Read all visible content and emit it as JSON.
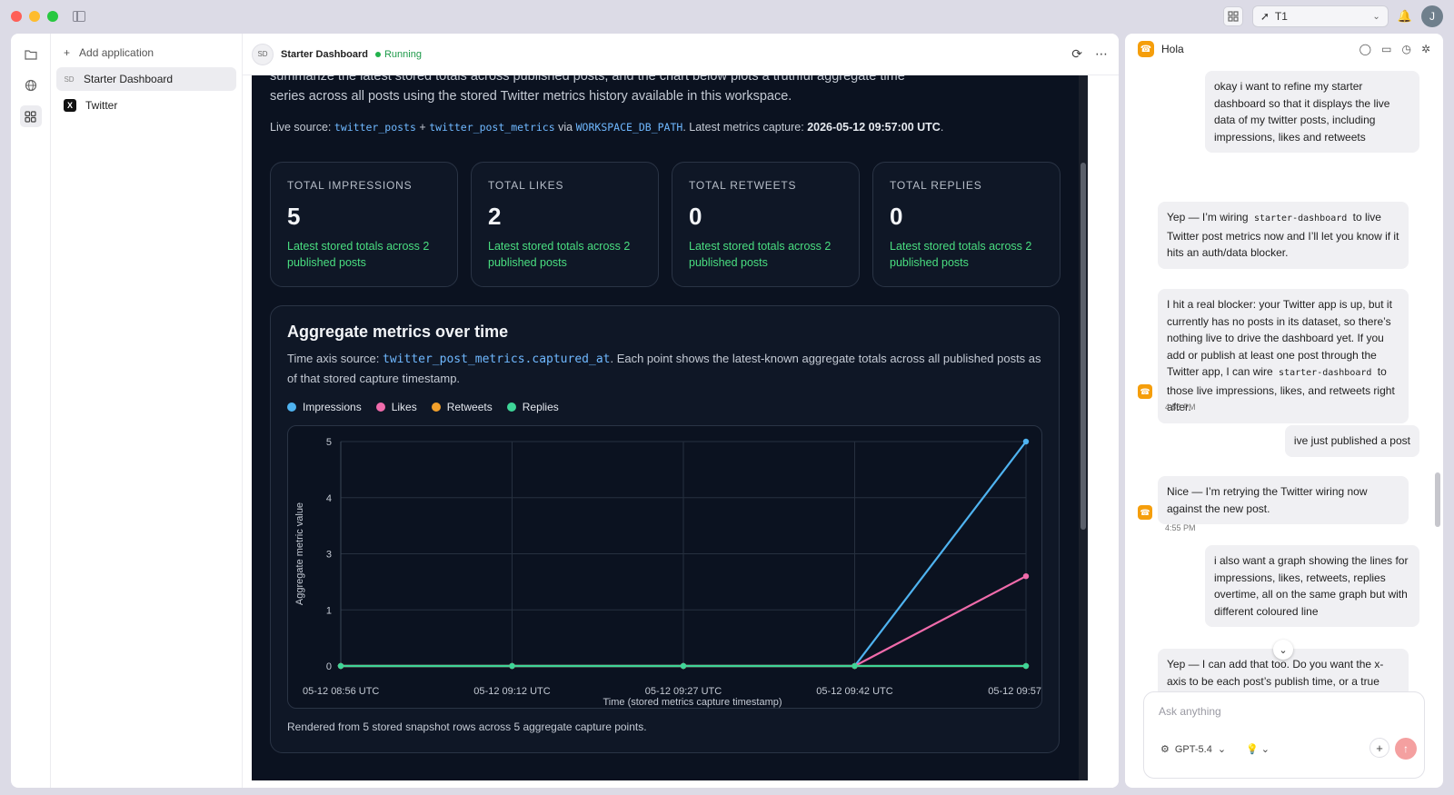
{
  "window": {
    "workspace": "T1",
    "avatar_initial": "J"
  },
  "nav": {
    "add_label": "Add application",
    "items": [
      {
        "badge": "SD",
        "label": "Starter Dashboard"
      },
      {
        "badge": "X",
        "label": "Twitter"
      }
    ]
  },
  "app_header": {
    "chip": "SD",
    "title": "Starter Dashboard",
    "status": "Running"
  },
  "dashboard": {
    "intro": "summarize the latest stored totals across published posts, and the chart below plots a truthful aggregate time series across all posts using the stored Twitter metrics history available in this workspace.",
    "live_source_prefix": "Live source:",
    "live_source_table1": "twitter_posts",
    "plus": "+",
    "live_source_table2": "twitter_post_metrics",
    "via": "via",
    "db_path": "WORKSPACE_DB_PATH",
    "capture_prefix": ". Latest metrics capture:",
    "capture_time": "2026-05-12 09:57:00 UTC",
    "period": ".",
    "cards": [
      {
        "label": "TOTAL IMPRESSIONS",
        "value": "5",
        "sub": "Latest stored totals across 2 published posts"
      },
      {
        "label": "TOTAL LIKES",
        "value": "2",
        "sub": "Latest stored totals across 2 published posts"
      },
      {
        "label": "TOTAL RETWEETS",
        "value": "0",
        "sub": "Latest stored totals across 2 published posts"
      },
      {
        "label": "TOTAL REPLIES",
        "value": "0",
        "sub": "Latest stored totals across 2 published posts"
      }
    ],
    "chart_title": "Aggregate metrics over time",
    "chart_desc_prefix": "Time axis source:",
    "chart_desc_field": "twitter_post_metrics.captured_at",
    "chart_desc_suffix": ". Each point shows the latest-known aggregate totals across all published posts as of that stored capture timestamp.",
    "footnote": "Rendered from 5 stored snapshot rows across 5 aggregate capture points."
  },
  "chart_data": {
    "type": "line",
    "title": "Aggregate metrics over time",
    "xlabel": "Time (stored metrics capture timestamp)",
    "ylabel": "Aggregate metric value",
    "categories": [
      "05-12 08:56 UTC",
      "05-12 09:12 UTC",
      "05-12 09:27 UTC",
      "05-12 09:42 UTC",
      "05-12 09:57"
    ],
    "y_ticks": [
      "0",
      "1",
      "3",
      "4",
      "5"
    ],
    "ylim": [
      0,
      5
    ],
    "grid": true,
    "legend": "top-left",
    "series": [
      {
        "name": "Impressions",
        "color": "#4fb3f0",
        "values": [
          0,
          0,
          0,
          0,
          5
        ]
      },
      {
        "name": "Likes",
        "color": "#f06bab",
        "values": [
          0,
          0,
          0,
          0,
          2
        ]
      },
      {
        "name": "Retweets",
        "color": "#f2a02b",
        "values": [
          0,
          0,
          0,
          0,
          0
        ]
      },
      {
        "name": "Replies",
        "color": "#3ed598",
        "values": [
          0,
          0,
          0,
          0,
          0
        ]
      }
    ]
  },
  "chat": {
    "title": "Hola",
    "messages": [
      {
        "role": "user",
        "text": "okay i want to refine my starter dashboard so that it displays the live data of my twitter posts, including impressions, likes and retweets"
      },
      {
        "role": "bot",
        "pre": "Yep — I’m wiring ",
        "code": "starter-dashboard",
        "post": " to live Twitter post metrics now and I’ll let you know if it hits an auth/data blocker."
      },
      {
        "role": "bot",
        "pre": "I hit a real blocker: your Twitter app is up, but it currently has no posts in its dataset, so there’s nothing live to drive the dashboard yet. If you add or publish at least one post through the Twitter app, I can wire ",
        "code": "starter-dashboard",
        "post": " to those live impressions, likes, and retweets right after.",
        "time": "4:53 PM"
      },
      {
        "role": "user",
        "text": "ive just published a post"
      },
      {
        "role": "bot",
        "pre": "Nice — I’m retrying the Twitter wiring now against the new post.",
        "code": "",
        "post": "",
        "time": "4:55 PM"
      },
      {
        "role": "user",
        "text": "i also want a graph showing the lines for impressions, likes, retweets, replies overtime, all on the same graph but with different coloured line"
      },
      {
        "role": "bot",
        "pre": "Yep — I can add that too. Do you want the x-axis to be each post’s publish time, or a true metrics-history timeline that tracks how",
        "code": "",
        "post": ""
      }
    ],
    "composer_placeholder": "Ask anything",
    "model": "GPT-5.4"
  }
}
